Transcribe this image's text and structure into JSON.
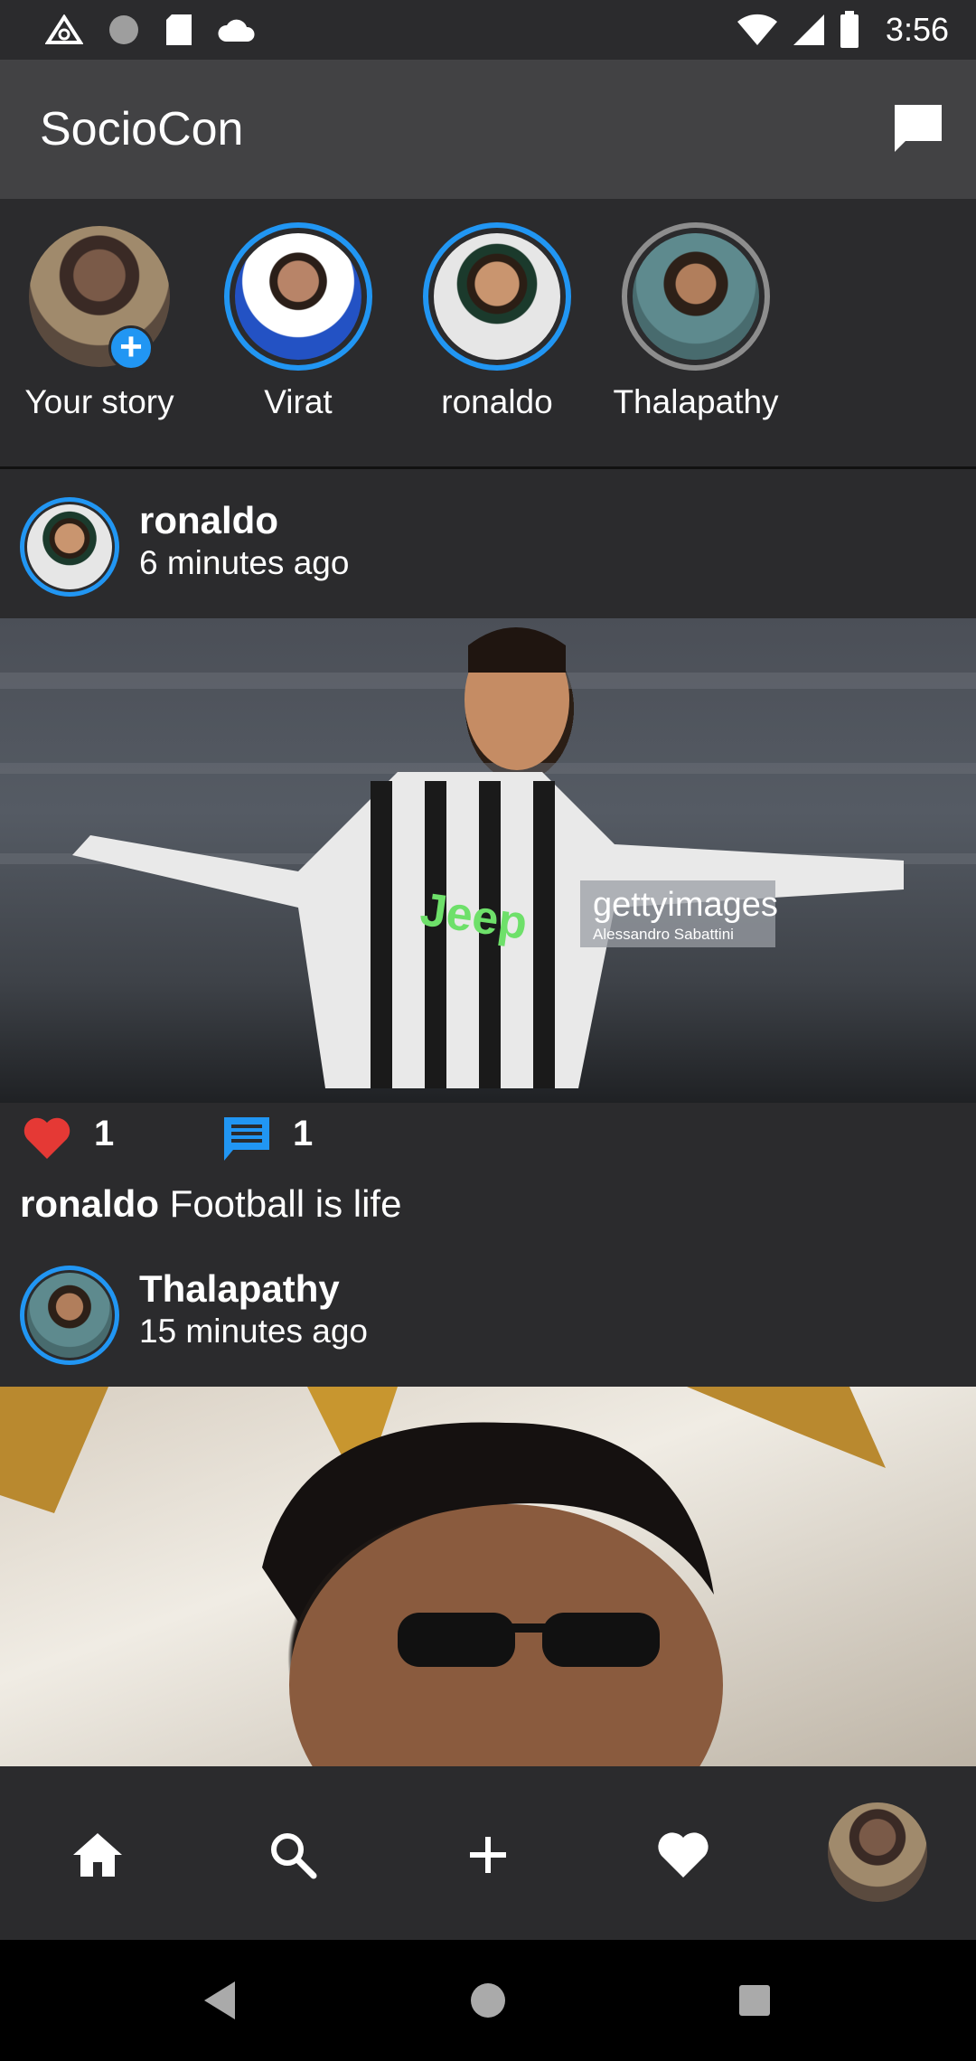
{
  "status_bar": {
    "time": "3:56"
  },
  "app_bar": {
    "title": "SocioCon"
  },
  "stories": [
    {
      "name": "Your story"
    },
    {
      "name": "Virat"
    },
    {
      "name": "ronaldo"
    },
    {
      "name": "Thalapathy"
    }
  ],
  "posts": [
    {
      "user": "ronaldo",
      "time": "6 minutes ago",
      "likes": "1",
      "comments": "1",
      "caption_user": "ronaldo",
      "caption_text": "Football is life",
      "image_watermark": "gettyimages",
      "image_credit": "Alessandro Sabattini",
      "image_text": "Jeep"
    },
    {
      "user": "Thalapathy",
      "time": "15 minutes ago"
    }
  ],
  "colors": {
    "background": "#2b2b2d",
    "app_bar": "#424244",
    "accent": "#2196f3",
    "like": "#e53935"
  },
  "icons": [
    "home-icon",
    "search-icon",
    "add-icon",
    "heart-icon",
    "chat-icon",
    "comment-icon"
  ]
}
